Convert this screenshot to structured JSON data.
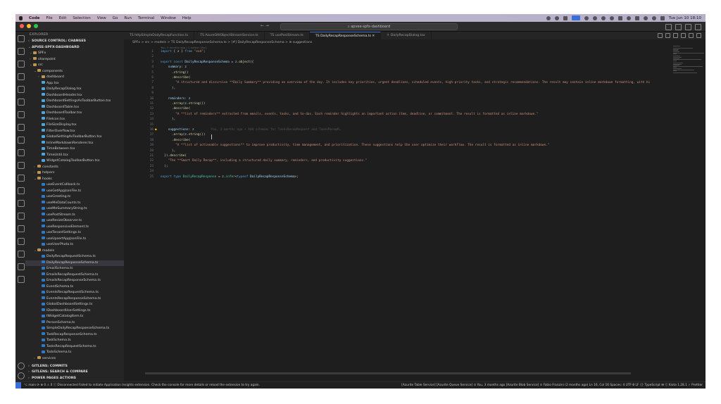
{
  "menubar": {
    "apple": "",
    "items": [
      "Code",
      "File",
      "Edit",
      "Selection",
      "View",
      "Go",
      "Run",
      "Terminal",
      "Window",
      "Help"
    ],
    "clock": "Tue Jun 10  18:10"
  },
  "titlebar": {
    "search": "⌕ apvee-spfx-dashboard",
    "nav": "←  →"
  },
  "sidebar": {
    "header": "EXPLORER",
    "sections": {
      "source_control": "SOURCE CONTROL: CHANGES",
      "project": "APVEE-SPFX-DASHBOARD"
    },
    "tree": [
      {
        "label": "SPFx",
        "depth": 1,
        "type": "folder",
        "open": true
      },
      {
        "label": "sharepoint",
        "depth": 1,
        "type": "folder",
        "open": false
      },
      {
        "label": "src",
        "depth": 1,
        "type": "folder",
        "open": true
      },
      {
        "label": "components",
        "depth": 2,
        "type": "folder",
        "open": true
      },
      {
        "label": "dashboard",
        "depth": 3,
        "type": "folder",
        "open": false
      },
      {
        "label": "App.tsx",
        "depth": 3,
        "type": "tsx"
      },
      {
        "label": "DailyRecapDialog.tsx",
        "depth": 3,
        "type": "tsx"
      },
      {
        "label": "DashboardHeader.tsx",
        "depth": 3,
        "type": "tsx"
      },
      {
        "label": "DashboardSettingsAsToolbarButton.tsx",
        "depth": 3,
        "type": "tsx"
      },
      {
        "label": "DashboardTable.tsx",
        "depth": 3,
        "type": "tsx"
      },
      {
        "label": "DashboardToolbar.tsx",
        "depth": 3,
        "type": "tsx"
      },
      {
        "label": "FileIcon.tsx",
        "depth": 3,
        "type": "tsx"
      },
      {
        "label": "FileSizeDisplay.tsx",
        "depth": 3,
        "type": "tsx"
      },
      {
        "label": "FilterOverflow.tsx",
        "depth": 3,
        "type": "tsx"
      },
      {
        "label": "GlobalSettingAsToolbarButton.tsx",
        "depth": 3,
        "type": "tsx"
      },
      {
        "label": "InlineMarkdownRenderer.tsx",
        "depth": 3,
        "type": "tsx"
      },
      {
        "label": "TimeBetween.tsx",
        "depth": 3,
        "type": "tsx"
      },
      {
        "label": "TimeUntil.tsx",
        "depth": 3,
        "type": "tsx"
      },
      {
        "label": "WidgetCatalogToolbarButton.tsx",
        "depth": 3,
        "type": "tsx"
      },
      {
        "label": "constants",
        "depth": 2,
        "type": "folder",
        "open": false
      },
      {
        "label": "helpers",
        "depth": 2,
        "type": "folder",
        "open": false
      },
      {
        "label": "hooks",
        "depth": 2,
        "type": "folder",
        "open": true
      },
      {
        "label": "useEventCallback.ts",
        "depth": 3,
        "type": "ts"
      },
      {
        "label": "useGetAppJsonFile.ts",
        "depth": 3,
        "type": "ts"
      },
      {
        "label": "useGreeting.ts",
        "depth": 3,
        "type": "ts"
      },
      {
        "label": "useMeDataCounts.ts",
        "depth": 3,
        "type": "ts"
      },
      {
        "label": "useMeSummaryString.ts",
        "depth": 3,
        "type": "ts"
      },
      {
        "label": "usePostStream.ts",
        "depth": 3,
        "type": "ts"
      },
      {
        "label": "useResizeObserver.ts",
        "depth": 3,
        "type": "ts"
      },
      {
        "label": "useResponsiveElement.ts",
        "depth": 3,
        "type": "ts"
      },
      {
        "label": "useTenantSettings.ts",
        "depth": 3,
        "type": "ts"
      },
      {
        "label": "useUpsertAppJsonFile.ts",
        "depth": 3,
        "type": "ts"
      },
      {
        "label": "useUserPhoto.ts",
        "depth": 3,
        "type": "ts"
      },
      {
        "label": "models",
        "depth": 2,
        "type": "folder",
        "open": true
      },
      {
        "label": "DailyRecapRequestSchema.ts",
        "depth": 3,
        "type": "ts"
      },
      {
        "label": "DailyRecapResponseSchema.ts",
        "depth": 3,
        "type": "ts",
        "selected": true
      },
      {
        "label": "EmailSchema.ts",
        "depth": 3,
        "type": "ts"
      },
      {
        "label": "EmailsRecapRequestSchema.ts",
        "depth": 3,
        "type": "ts"
      },
      {
        "label": "EmailsRecapResponseSchema.ts",
        "depth": 3,
        "type": "ts"
      },
      {
        "label": "EventSchema.ts",
        "depth": 3,
        "type": "ts"
      },
      {
        "label": "EventsRecapRequestSchema.ts",
        "depth": 3,
        "type": "ts"
      },
      {
        "label": "EventsRecapResponseSchema.ts",
        "depth": 3,
        "type": "ts"
      },
      {
        "label": "GlobalDashboardSettings.ts",
        "depth": 3,
        "type": "ts"
      },
      {
        "label": "IDashboardUserSettings.ts",
        "depth": 3,
        "type": "ts"
      },
      {
        "label": "IWidgetCatalogItem.ts",
        "depth": 3,
        "type": "ts"
      },
      {
        "label": "PersonSchema.ts",
        "depth": 3,
        "type": "ts"
      },
      {
        "label": "SimpleDailyRecapResponseSchema.ts",
        "depth": 3,
        "type": "ts"
      },
      {
        "label": "TaskRecapResponseSchema.ts",
        "depth": 3,
        "type": "ts"
      },
      {
        "label": "TaskSchema.ts",
        "depth": 3,
        "type": "ts"
      },
      {
        "label": "TasksRecapRequestSchema.ts",
        "depth": 3,
        "type": "ts"
      },
      {
        "label": "TodoSchema.ts",
        "depth": 3,
        "type": "ts"
      },
      {
        "label": "services",
        "depth": 2,
        "type": "folder",
        "open": false
      }
    ],
    "bottom_sections": [
      "GITLENS: COMMITS",
      "GITLENS: SEARCH & COMPARE",
      "POWER PAGES ACTIONS"
    ]
  },
  "editor": {
    "tabs": [
      {
        "label": "TS  httpSimpleDailyRecapFunction.ts",
        "active": false
      },
      {
        "label": "TS  AzureOAIObjectStreamService.ts",
        "active": false
      },
      {
        "label": "TS  usePostStream.ts",
        "active": false
      },
      {
        "label": "TS  DailyRecapResponseSchema.ts  ✕",
        "active": true
      },
      {
        "label": "⚛  DailyRecapDialog.tsx",
        "active": false
      }
    ],
    "breadcrumb": "SPFx  >  src  >  models  >  TS DailyRecapResponseSchema.ts  >  [#] DailyRecapResponseSchema  >  ⊘ suggestions",
    "blame": "You, 3 months ago | 1 author (You)",
    "lines": [
      {
        "n": "1",
        "html": "<span class='kw'>import</span> <span class='pl'>{ z }</span> <span class='kw'>from</span> <span class='str'>\"zod\"</span><span class='pl'>;</span>"
      },
      {
        "n": "2",
        "html": ""
      },
      {
        "n": "3",
        "html": "<span class='kw'>export const</span> <span class='id'>DailyRecapResponseSchema</span> <span class='pl'>=</span> <span class='id'>z</span><span class='pl'>.</span><span class='fn'>object</span><span class='pl'>({</span>"
      },
      {
        "n": "4",
        "html": "    <span class='id'>summary</span><span class='pl'>:</span> <span class='id'>z</span>"
      },
      {
        "n": "5",
        "html": "      <span class='pl'>.</span><span class='fn'>string</span><span class='pl'>()</span>"
      },
      {
        "n": "6",
        "html": "      <span class='pl'>.</span><span class='fn'>describe</span><span class='pl'>(</span>"
      },
      {
        "n": "7",
        "html": "        <span class='str'>\"A structured and discursive **Daily Summary** providing an overview of the day. It includes key priorities, urgent deadlines, scheduled events, high-priority tasks, and strategic recommendations. The result may contain inline markdown formatting, with hi</span>"
      },
      {
        "n": "8",
        "html": "      <span class='pl'>),</span>"
      },
      {
        "n": "9",
        "html": ""
      },
      {
        "n": "10",
        "html": "    <span class='id'>reminders</span><span class='pl'>:</span> <span class='id'>z</span>"
      },
      {
        "n": "11",
        "html": "      <span class='pl'>.</span><span class='fn'>array</span><span class='pl'>(</span><span class='id'>z</span><span class='pl'>.</span><span class='fn'>string</span><span class='pl'>())</span>"
      },
      {
        "n": "12",
        "html": "      <span class='pl'>.</span><span class='fn'>describe</span><span class='pl'>(</span>"
      },
      {
        "n": "13",
        "html": "        <span class='str'>\"A **list of reminders** extracted from emails, events, tasks, and to-dos. Each reminder highlights an important action item, deadline, or commitment. The result is formatted as inline markdown.\"</span>"
      },
      {
        "n": "14",
        "html": "      <span class='pl'>),</span>"
      },
      {
        "n": "15",
        "html": ""
      },
      {
        "n": "16",
        "html": "    <span class='id'>suggestions</span><span class='pl'>:</span> <span class='id'>z</span>         <span class='ghost'>You, 3 months ago • Add schemas for TasksRecapRequest and TasksRecapR…</span>"
      },
      {
        "n": "17",
        "html": "      <span class='pl'>.</span><span class='fn'>array</span><span class='pl'>(</span><span class='id'>z</span><span class='pl'>.</span><span class='fn'>string</span><span class='pl'>())</span>"
      },
      {
        "n": "18",
        "html": "      <span class='pl'>.</span><span class='fn'>describe</span><span class='pl'>(</span>"
      },
      {
        "n": "19",
        "html": "        <span class='str'>\"A **list of actionable suggestions** to improve productivity, time management, and prioritization. These suggestions help the user optimize their workflow. The result is formatted as inline markdown.\"</span>"
      },
      {
        "n": "20",
        "html": "      <span class='pl'>),</span>"
      },
      {
        "n": "21",
        "html": "  <span class='pl'>})</span><span class='pl'>.</span><span class='fn'>describe</span><span class='pl'>(</span>"
      },
      {
        "n": "22",
        "html": "    <span class='str'>\"The **Smart Daily Recap**, including a structured daily summary, reminders, and productivity suggestions.\"</span>"
      },
      {
        "n": "23",
        "html": "  <span class='pl'>);</span>"
      },
      {
        "n": "24",
        "html": ""
      },
      {
        "n": "25",
        "html": "<span class='kw'>export type</span> <span class='ty'>DailyRecapResponse</span> <span class='pl'>=</span> <span class='id'>z</span><span class='pl'>.</span><span class='ty'>infer</span><span class='pl'>&lt;</span><span class='kw'>typeof</span> <span class='id'>DailyRecapResponseSchema</span><span class='pl'>&gt;;</span>"
      }
    ]
  },
  "statusbar": {
    "left": "⌥ main  ⟳  ⊗ 0 ⚠ 0  ⓘ Disconnected   Failed to initiate Application Insights extension. Check the console for more details or reload the extension to try again.",
    "right": "[Azurite Table Service]   [Azurite Queue Service]   ⊙ You, 3 months ago   [Azurite Blob Service]   ⊙ Fabio Franzini (2 months ago)   Ln 16, Col 16   Spaces: 4   UTF-8   LF   {} TypeScript   ⊞   ⓒ Kiota 1.28.1   ✓ Prettier"
  }
}
